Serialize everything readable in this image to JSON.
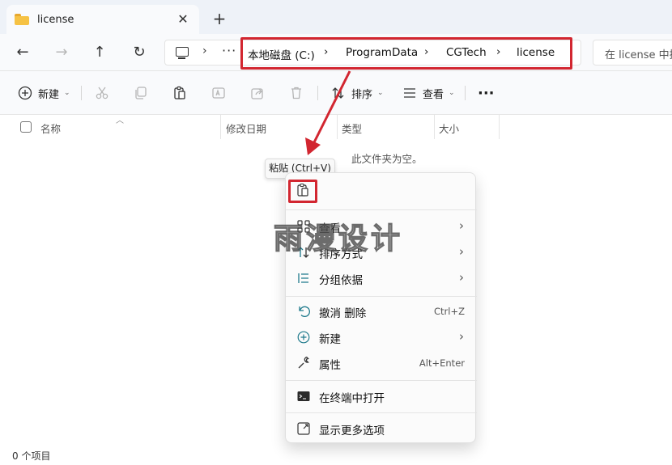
{
  "tab": {
    "title": "license",
    "close_glyph": "✕",
    "new_glyph": "+"
  },
  "nav": {
    "back": "←",
    "forward": "→",
    "up": "↑",
    "refresh": "↻"
  },
  "address": {
    "ellipsis": "···",
    "crumbs": [
      "本地磁盘 (C:)",
      "ProgramData",
      "CGTech",
      "license"
    ],
    "separator": "›"
  },
  "search": {
    "placeholder": "在 license 中搜索"
  },
  "toolbar": {
    "new_label": "新建",
    "sort_label": "排序",
    "view_label": "查看",
    "more_label": "···"
  },
  "columns": {
    "name": "名称",
    "modified": "修改日期",
    "type": "类型",
    "size": "大小"
  },
  "empty_text": "此文件夹为空。",
  "tooltip": "粘贴 (Ctrl+V)",
  "context_menu": {
    "view": "查看",
    "sort_by": "排序方式",
    "group_by": "分组依据",
    "undo": "撤消 删除",
    "undo_shortcut": "Ctrl+Z",
    "new": "新建",
    "properties": "属性",
    "properties_shortcut": "Alt+Enter",
    "open_terminal": "在终端中打开",
    "more_options": "显示更多选项",
    "chevron": "›"
  },
  "status": {
    "items": "0 个项目"
  },
  "watermark": "雨漫设计",
  "colors": {
    "accent_red": "#d22630",
    "folder_yellow": "#f6c244",
    "icon_teal": "#1f7a8c"
  }
}
